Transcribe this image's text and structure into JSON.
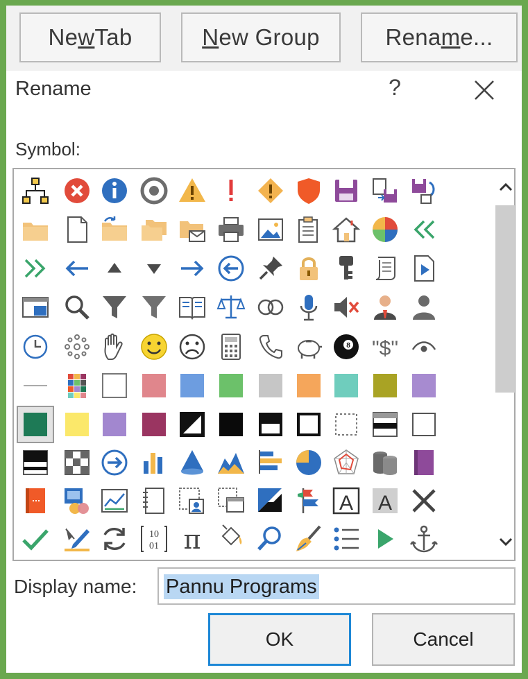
{
  "toolbar": {
    "buttons": [
      {
        "pre": "Ne",
        "u": "w",
        "post": " Tab"
      },
      {
        "pre": "",
        "u": "N",
        "post": "ew Group"
      },
      {
        "pre": "Rena",
        "u": "m",
        "post": "e..."
      }
    ]
  },
  "dialog": {
    "title": "Rename",
    "help": "?"
  },
  "symbol": {
    "label": "Symbol:",
    "icons": [
      [
        "org-chart",
        "error-x",
        "info",
        "target-ring",
        "warning-triangle",
        "exclamation",
        "warning-diamond",
        "shield",
        "floppy",
        "copy-save",
        "save-sync"
      ],
      [
        "folder",
        "blank-doc",
        "folder-arrow",
        "folders",
        "folder-mail",
        "printer",
        "image",
        "paste-list",
        "home",
        "pie-color",
        "double-arrow-left"
      ],
      [
        "double-arrow-right",
        "arrow-left",
        "triangle-up",
        "triangle-down",
        "arrow-right",
        "circle-arrow-left",
        "pin",
        "padlock",
        "key",
        "scroll",
        "doc-play"
      ],
      [
        "window-view",
        "magnifier",
        "funnel",
        "funnel-2",
        "open-book",
        "scales",
        "rings",
        "microphone",
        "mute",
        "person-tie",
        "person"
      ],
      [
        "clock",
        "sparkle",
        "hand",
        "smiley",
        "frown",
        "calculator",
        "phone",
        "piggy-bank",
        "eight-ball",
        "dollar-quotes",
        "eye"
      ],
      [
        "line",
        "color-grid",
        "sq-white",
        "sq-rose",
        "sq-blue",
        "sq-green",
        "sq-silver",
        "sq-orange",
        "sq-teal",
        "sq-olive",
        "sq-lavender"
      ],
      [
        "sq-dkgreen",
        "sq-yellow",
        "sq-purple",
        "sq-maroon",
        "half-diagonal",
        "sq-black",
        "window-dark",
        "square-outline-thick",
        "square-dashed",
        "window-bar",
        "square-outline"
      ],
      [
        "window-black",
        "checker",
        "circle-arrow-right",
        "bar-chart",
        "cone",
        "area-mountain",
        "bar-horizontal",
        "pie-blue",
        "radar",
        "database",
        "book-purple"
      ],
      [
        "book-orange",
        "pictures",
        "chart-window",
        "notebook",
        "doc-picture",
        "window-dashed",
        "diagonal-fill",
        "flags",
        "text-a-outline",
        "text-a-shaded",
        "x-cross"
      ],
      [
        "checkmark",
        "pen-edit",
        "refresh",
        "binary",
        "pi",
        "bucket",
        "search-blue",
        "brush",
        "bullet-list",
        "play-green",
        "anchor"
      ]
    ]
  },
  "display_name": {
    "label": "Display name:",
    "value": "Pannu Programs"
  },
  "buttons": {
    "ok": "OK",
    "cancel": "Cancel"
  },
  "colors": {
    "frame": "#6aa84f",
    "ok_border": "#1e88d6",
    "selection": "#b9d7f3"
  }
}
